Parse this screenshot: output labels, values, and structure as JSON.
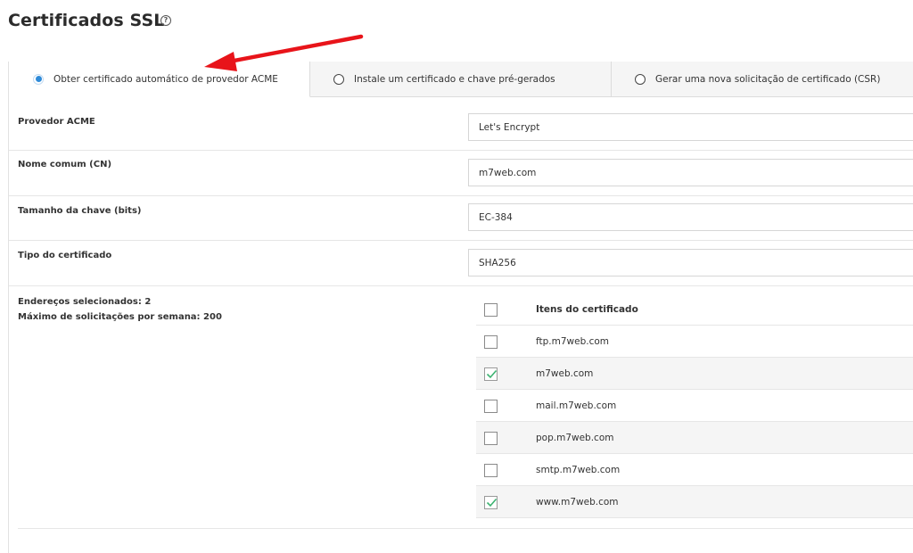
{
  "page": {
    "title": "Certificados SSL",
    "help_icon": "?"
  },
  "tabs": [
    {
      "label": "Obter certificado automático de provedor ACME",
      "selected": true
    },
    {
      "label": "Instale um certificado e chave pré-gerados",
      "selected": false
    },
    {
      "label": "Gerar uma nova solicitação de certificado (CSR)",
      "selected": false
    }
  ],
  "form": {
    "provider": {
      "label": "Provedor ACME",
      "value": "Let's Encrypt"
    },
    "common_name": {
      "label": "Nome comum (CN)",
      "value": "m7web.com"
    },
    "key_size": {
      "label": "Tamanho da chave (bits)",
      "value": "EC-384"
    },
    "cert_type": {
      "label": "Tipo do certificado",
      "value": "SHA256"
    }
  },
  "summary": {
    "selected": "Endereços selecionados: 2",
    "max_requests": "Máximo de solicitações por semana: 200"
  },
  "cert_items": {
    "header": "Itens do certificado",
    "rows": [
      {
        "name": "ftp.m7web.com",
        "checked": false
      },
      {
        "name": "m7web.com",
        "checked": true
      },
      {
        "name": "mail.m7web.com",
        "checked": false
      },
      {
        "name": "pop.m7web.com",
        "checked": false
      },
      {
        "name": "smtp.m7web.com",
        "checked": false
      },
      {
        "name": "www.m7web.com",
        "checked": true
      }
    ]
  },
  "colors": {
    "accent": "#2f8bd8",
    "check": "#3cb371",
    "annotation_arrow": "#e8141a"
  }
}
